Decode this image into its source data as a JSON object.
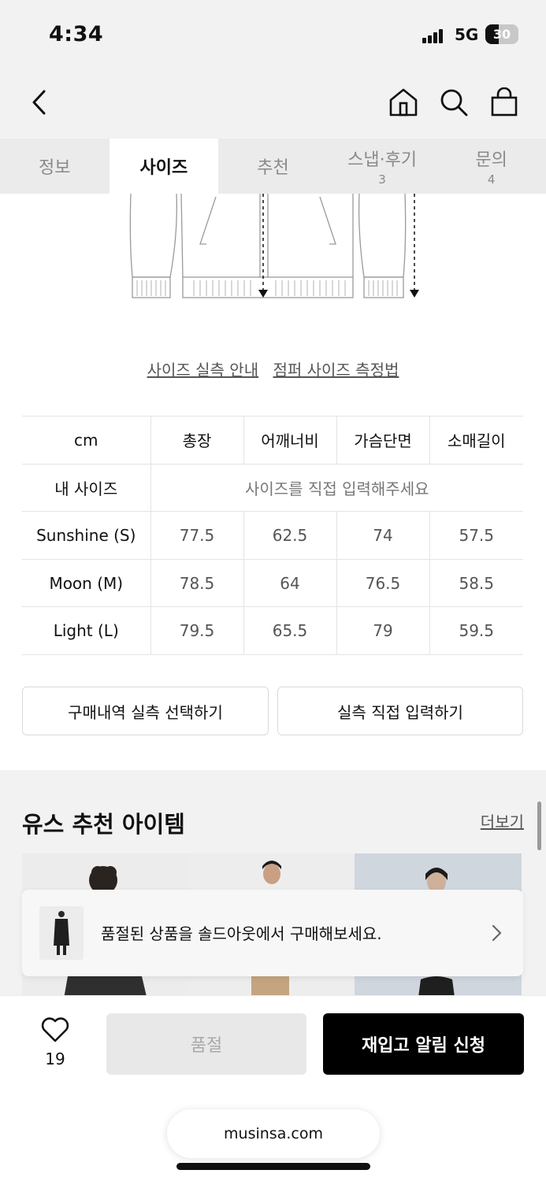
{
  "status_bar": {
    "time": "4:34",
    "network": "5G",
    "battery": "30"
  },
  "header": {
    "icons": [
      "back-arrow-icon",
      "home-icon",
      "search-icon",
      "shopping-bag-icon"
    ]
  },
  "tabs": [
    {
      "label": "정보",
      "count": ""
    },
    {
      "label": "사이즈",
      "count": ""
    },
    {
      "label": "추천",
      "count": ""
    },
    {
      "label": "스냅·후기",
      "count": "3"
    },
    {
      "label": "문의",
      "count": "4"
    }
  ],
  "active_tab": "사이즈",
  "size_guides": {
    "actual_size": "사이즈 실측 안내",
    "measure_method": "점퍼 사이즈 측정법"
  },
  "size_table": {
    "headers": [
      "cm",
      "총장",
      "어깨너비",
      "가슴단면",
      "소매길이"
    ],
    "my_size": {
      "label": "내 사이즈",
      "hint": "사이즈를 직접 입력해주세요"
    },
    "rows": [
      {
        "size": "Sunshine (S)",
        "values": [
          "77.5",
          "62.5",
          "74",
          "57.5"
        ]
      },
      {
        "size": "Moon (M)",
        "values": [
          "78.5",
          "64",
          "76.5",
          "58.5"
        ]
      },
      {
        "size": "Light (L)",
        "values": [
          "79.5",
          "65.5",
          "79",
          "59.5"
        ]
      }
    ]
  },
  "actions": {
    "select_history": "구매내역 실측 선택하기",
    "direct_input": "실측 직접 입력하기"
  },
  "recommend": {
    "title": "유스 추천 아이템",
    "more": "더보기"
  },
  "toast": {
    "text": "품절된 상품을 솔드아웃에서 구매해보세요."
  },
  "bottom_bar": {
    "like_count": "19",
    "soldout_label": "품절",
    "restock_label": "재입고 알림 신청",
    "url": "musinsa.com"
  }
}
